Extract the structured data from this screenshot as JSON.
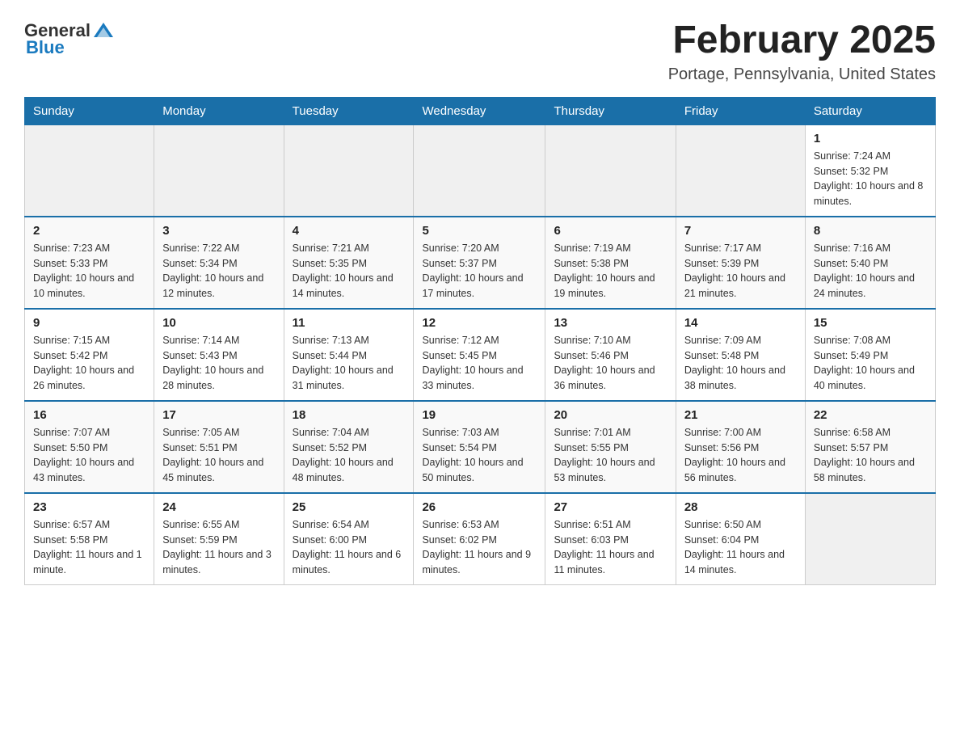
{
  "header": {
    "logo_general": "General",
    "logo_blue": "Blue",
    "title": "February 2025",
    "location": "Portage, Pennsylvania, United States"
  },
  "weekdays": [
    "Sunday",
    "Monday",
    "Tuesday",
    "Wednesday",
    "Thursday",
    "Friday",
    "Saturday"
  ],
  "weeks": [
    [
      {
        "day": "",
        "info": ""
      },
      {
        "day": "",
        "info": ""
      },
      {
        "day": "",
        "info": ""
      },
      {
        "day": "",
        "info": ""
      },
      {
        "day": "",
        "info": ""
      },
      {
        "day": "",
        "info": ""
      },
      {
        "day": "1",
        "info": "Sunrise: 7:24 AM\nSunset: 5:32 PM\nDaylight: 10 hours and 8 minutes."
      }
    ],
    [
      {
        "day": "2",
        "info": "Sunrise: 7:23 AM\nSunset: 5:33 PM\nDaylight: 10 hours and 10 minutes."
      },
      {
        "day": "3",
        "info": "Sunrise: 7:22 AM\nSunset: 5:34 PM\nDaylight: 10 hours and 12 minutes."
      },
      {
        "day": "4",
        "info": "Sunrise: 7:21 AM\nSunset: 5:35 PM\nDaylight: 10 hours and 14 minutes."
      },
      {
        "day": "5",
        "info": "Sunrise: 7:20 AM\nSunset: 5:37 PM\nDaylight: 10 hours and 17 minutes."
      },
      {
        "day": "6",
        "info": "Sunrise: 7:19 AM\nSunset: 5:38 PM\nDaylight: 10 hours and 19 minutes."
      },
      {
        "day": "7",
        "info": "Sunrise: 7:17 AM\nSunset: 5:39 PM\nDaylight: 10 hours and 21 minutes."
      },
      {
        "day": "8",
        "info": "Sunrise: 7:16 AM\nSunset: 5:40 PM\nDaylight: 10 hours and 24 minutes."
      }
    ],
    [
      {
        "day": "9",
        "info": "Sunrise: 7:15 AM\nSunset: 5:42 PM\nDaylight: 10 hours and 26 minutes."
      },
      {
        "day": "10",
        "info": "Sunrise: 7:14 AM\nSunset: 5:43 PM\nDaylight: 10 hours and 28 minutes."
      },
      {
        "day": "11",
        "info": "Sunrise: 7:13 AM\nSunset: 5:44 PM\nDaylight: 10 hours and 31 minutes."
      },
      {
        "day": "12",
        "info": "Sunrise: 7:12 AM\nSunset: 5:45 PM\nDaylight: 10 hours and 33 minutes."
      },
      {
        "day": "13",
        "info": "Sunrise: 7:10 AM\nSunset: 5:46 PM\nDaylight: 10 hours and 36 minutes."
      },
      {
        "day": "14",
        "info": "Sunrise: 7:09 AM\nSunset: 5:48 PM\nDaylight: 10 hours and 38 minutes."
      },
      {
        "day": "15",
        "info": "Sunrise: 7:08 AM\nSunset: 5:49 PM\nDaylight: 10 hours and 40 minutes."
      }
    ],
    [
      {
        "day": "16",
        "info": "Sunrise: 7:07 AM\nSunset: 5:50 PM\nDaylight: 10 hours and 43 minutes."
      },
      {
        "day": "17",
        "info": "Sunrise: 7:05 AM\nSunset: 5:51 PM\nDaylight: 10 hours and 45 minutes."
      },
      {
        "day": "18",
        "info": "Sunrise: 7:04 AM\nSunset: 5:52 PM\nDaylight: 10 hours and 48 minutes."
      },
      {
        "day": "19",
        "info": "Sunrise: 7:03 AM\nSunset: 5:54 PM\nDaylight: 10 hours and 50 minutes."
      },
      {
        "day": "20",
        "info": "Sunrise: 7:01 AM\nSunset: 5:55 PM\nDaylight: 10 hours and 53 minutes."
      },
      {
        "day": "21",
        "info": "Sunrise: 7:00 AM\nSunset: 5:56 PM\nDaylight: 10 hours and 56 minutes."
      },
      {
        "day": "22",
        "info": "Sunrise: 6:58 AM\nSunset: 5:57 PM\nDaylight: 10 hours and 58 minutes."
      }
    ],
    [
      {
        "day": "23",
        "info": "Sunrise: 6:57 AM\nSunset: 5:58 PM\nDaylight: 11 hours and 1 minute."
      },
      {
        "day": "24",
        "info": "Sunrise: 6:55 AM\nSunset: 5:59 PM\nDaylight: 11 hours and 3 minutes."
      },
      {
        "day": "25",
        "info": "Sunrise: 6:54 AM\nSunset: 6:00 PM\nDaylight: 11 hours and 6 minutes."
      },
      {
        "day": "26",
        "info": "Sunrise: 6:53 AM\nSunset: 6:02 PM\nDaylight: 11 hours and 9 minutes."
      },
      {
        "day": "27",
        "info": "Sunrise: 6:51 AM\nSunset: 6:03 PM\nDaylight: 11 hours and 11 minutes."
      },
      {
        "day": "28",
        "info": "Sunrise: 6:50 AM\nSunset: 6:04 PM\nDaylight: 11 hours and 14 minutes."
      },
      {
        "day": "",
        "info": ""
      }
    ]
  ]
}
